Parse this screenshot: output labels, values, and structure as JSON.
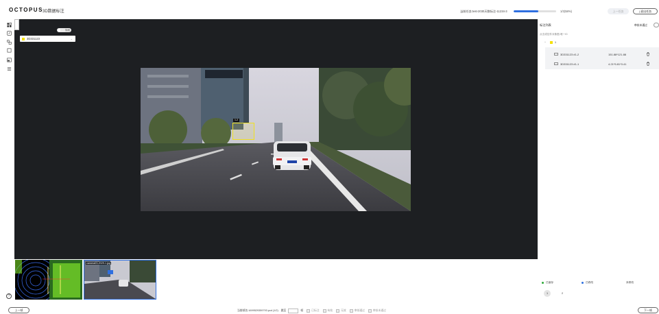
{
  "header": {
    "logo": "OCTOPUS",
    "app_title": "3D数据标注",
    "task_label": "当前任务:test-2030天数标注-11234-3",
    "progress": {
      "fraction": 0.58,
      "text": "1/2(58%)"
    },
    "prev_task_label": "上一任务",
    "exit_label": "| 退出任务"
  },
  "toolbar": {
    "icons": [
      "grid-icon",
      "edit-icon",
      "layers-icon",
      "square-icon",
      "image-icon",
      "list-icon"
    ]
  },
  "canvas": {
    "toggle_label": "隐藏",
    "object_selector": {
      "value": "3D331123",
      "swatch_color": "#f5e000"
    },
    "bbox_tag": "1-2"
  },
  "thumbnails": [
    {
      "type": "pointcloud"
    },
    {
      "type": "camera",
      "label": "camera03-2029-1.jpg",
      "selected": true
    }
  ],
  "right_panel": {
    "title": "标注列表",
    "toggle_label": "审核未通过",
    "subtitle": "点击或控件对象图-唯一ID",
    "group": {
      "name": "1",
      "color": "#f5e000"
    },
    "objects": [
      {
        "name": "3D331123 #1-2",
        "dims": "151.88*121.88"
      },
      {
        "name": "3D331123 #1-1",
        "dims": "4.21*5.81*3.41"
      }
    ],
    "legend": [
      {
        "label": "已保存",
        "color": "#2eaa3a"
      },
      {
        "label": "已修改",
        "color": "#2f6fe0"
      },
      {
        "label": "未修改",
        "color": "#999999"
      }
    ],
    "pages": [
      "1",
      "2"
    ]
  },
  "footer": {
    "prev_label": "上一帧",
    "next_label": "下一帧",
    "current_file": "当前帧名:1699529359793.pcd (1/2)",
    "jump_label": "跳至",
    "frame_unit": "帧",
    "filters": [
      "已标注",
      "有效",
      "无效",
      "审核通过",
      "审核未通过"
    ]
  }
}
